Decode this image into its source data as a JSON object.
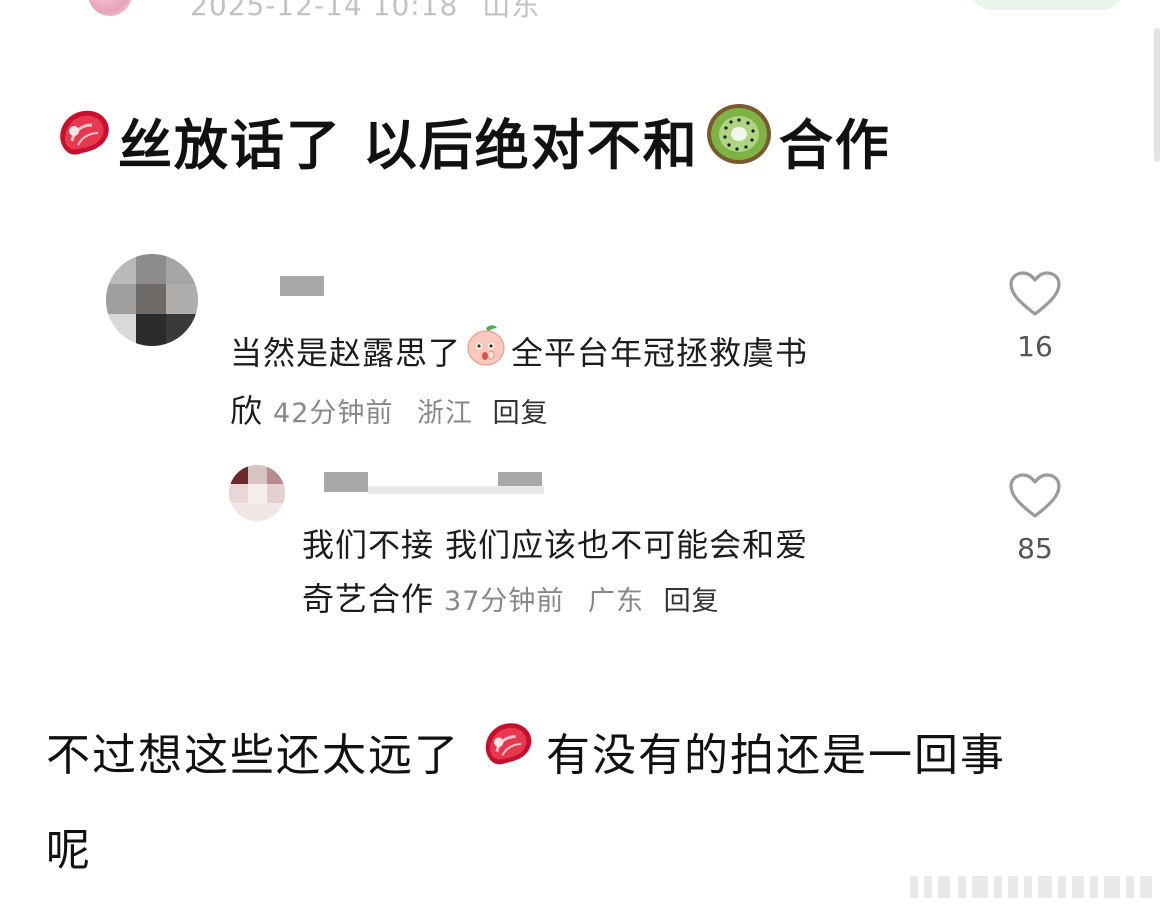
{
  "header": {
    "timestamp": "2025-12-14 10:18",
    "location": "山东"
  },
  "headline": {
    "emoji_1": "steak-emoji",
    "part1": "丝放话了 以后绝对不和",
    "emoji_2": "kiwi-emoji",
    "part2": "合作"
  },
  "comments": [
    {
      "text_line1": "当然是赵露思了",
      "emoji": "peach-face-emoji",
      "text_line1_cont": "全平台年冠拯救虞书",
      "text_line2": "欣",
      "time": "42分钟前",
      "region": "浙江",
      "reply_label": "回复",
      "likes": "16"
    },
    {
      "text_line1": "我们不接 我们应该也不可能会和爱",
      "text_line2": "奇艺合作",
      "time": "37分钟前",
      "region": "广东",
      "reply_label": "回复",
      "likes": "85"
    }
  ],
  "body": {
    "line1_part1": "不过想这些还太远了",
    "emoji": "steak-emoji",
    "line1_part2": "有没有的拍还是一回事",
    "line2": "呢"
  },
  "colors": {
    "meta_gray": "#888888",
    "like_icon_gray": "#9a9a9a",
    "top_button_green": "#e8f5ea"
  }
}
